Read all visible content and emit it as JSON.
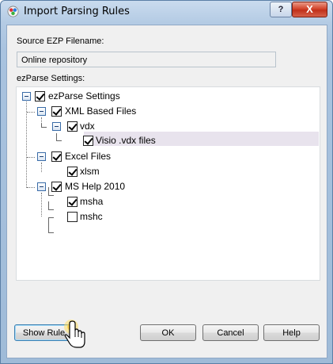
{
  "window": {
    "title": "Import Parsing Rules",
    "help_label": "?",
    "close_label": "X"
  },
  "source": {
    "label": "Source EZP Filename:",
    "value": "Online repository"
  },
  "settings": {
    "label": "ezParse Settings:"
  },
  "tree": {
    "root": {
      "label": "ezParse Settings",
      "checked": true,
      "expanded": true
    },
    "xml": {
      "label": "XML Based Files",
      "checked": true,
      "expanded": true
    },
    "vdx": {
      "label": "vdx",
      "checked": true,
      "expanded": true
    },
    "visio": {
      "label": "Visio .vdx files",
      "checked": true,
      "selected": true
    },
    "excel": {
      "label": "Excel Files",
      "checked": true,
      "expanded": true
    },
    "xlsm": {
      "label": "xlsm",
      "checked": true
    },
    "mshelp": {
      "label": "MS Help 2010",
      "checked": true,
      "expanded": true
    },
    "msha": {
      "label": "msha",
      "checked": true
    },
    "mshc": {
      "label": "mshc",
      "checked": false
    }
  },
  "buttons": {
    "show_rule": "Show Rule",
    "ok": "OK",
    "cancel": "Cancel",
    "help": "Help"
  },
  "colors": {
    "title_gradient_top": "#c9dbee",
    "client_bg": "#f0f0f0",
    "selection_bg": "#e8e3ed",
    "close_red": "#c0301b"
  }
}
